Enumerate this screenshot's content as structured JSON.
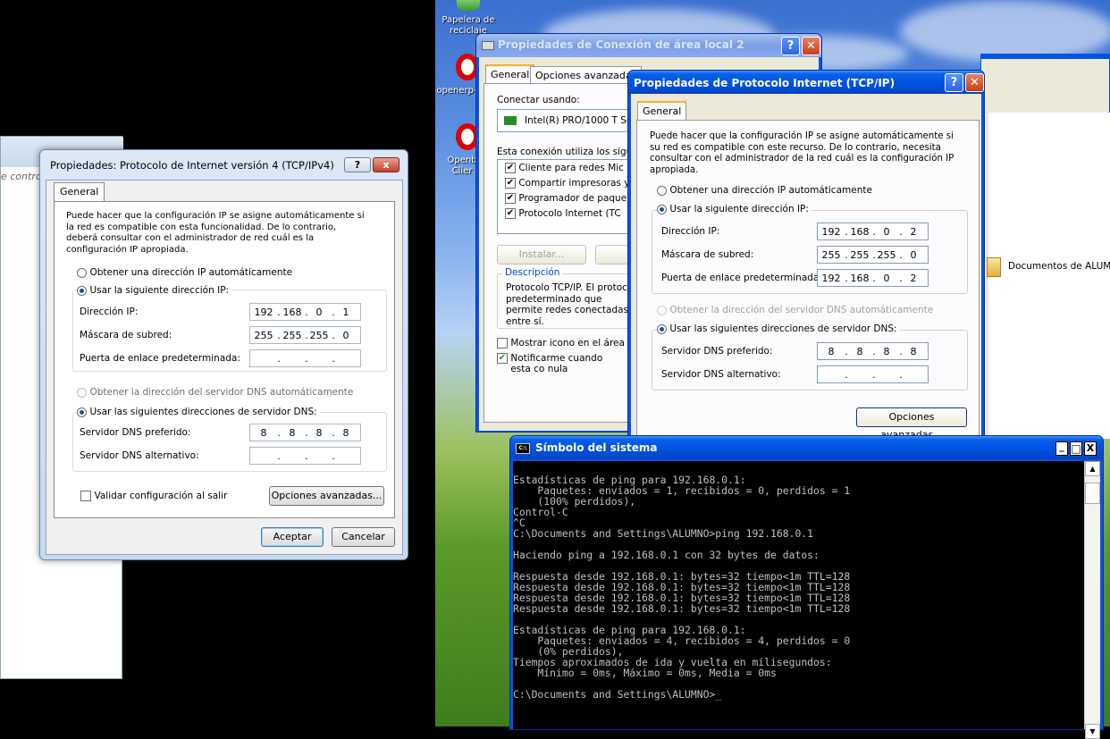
{
  "left_window": {
    "partial_text": "e contro",
    "dialog": {
      "title": "Propiedades: Protocolo de Internet versión 4 (TCP/IPv4)",
      "tab": "General",
      "description": "Puede hacer que la configuración IP se asigne automáticamente si la red es compatible con esta funcionalidad. De lo contrario, deberá consultar con el administrador de red cuál es la configuración IP apropiada.",
      "radio_auto_ip": "Obtener una dirección IP automáticamente",
      "radio_manual_ip": "Usar la siguiente dirección IP:",
      "ip_label": "Dirección IP:",
      "ip": [
        "192",
        "168",
        "0",
        "1"
      ],
      "mask_label": "Máscara de subred:",
      "mask": [
        "255",
        "255",
        "255",
        "0"
      ],
      "gateway_label": "Puerta de enlace predeterminada:",
      "gateway": [
        "",
        "",
        "",
        ""
      ],
      "radio_auto_dns": "Obtener la dirección del servidor DNS automáticamente",
      "radio_manual_dns": "Usar las siguientes direcciones de servidor DNS:",
      "dns_pref_label": "Servidor DNS preferido:",
      "dns_pref": [
        "8",
        "8",
        "8",
        "8"
      ],
      "dns_alt_label": "Servidor DNS alternativo:",
      "dns_alt": [
        "",
        "",
        "",
        ""
      ],
      "validate_label": "Validar configuración al salir",
      "advanced_button": "Opciones avanzadas...",
      "ok_button": "Aceptar",
      "cancel_button": "Cancelar",
      "help_glyph": "?",
      "close_glyph": "x"
    }
  },
  "desktop": {
    "icons": [
      "Papelera de reciclaje",
      "openerp-",
      "Openb Clier"
    ],
    "documents_label": "Documentos de ALUMNO"
  },
  "lan_dialog": {
    "title": "Propiedades de Conexión de área local 2",
    "tabs": [
      "General",
      "Opciones avanzadas"
    ],
    "connect_using_label": "Conectar usando:",
    "adapter": "Intel(R) PRO/1000 T Se",
    "components_label": "Esta conexión utiliza los siguien",
    "components": [
      "Cliente para redes Mic",
      "Compartir impresoras y",
      "Programador de paque",
      "Protocolo Internet (TC"
    ],
    "install_button": "Instalar...",
    "uninstall_button": "De",
    "description_title": "Descripción",
    "description_text": "Protocolo TCP/IP. El protoc predeterminado que permite redes conectadas entre sí.",
    "show_icon_label": "Mostrar icono en el área de",
    "notify_label": "Notificarme cuando esta co nula"
  },
  "tcp_dialog": {
    "title": "Propiedades de Protocolo Internet (TCP/IP)",
    "tab": "General",
    "description": "Puede hacer que la configuración IP se asigne automáticamente si su red es compatible con este recurso. De lo contrario, necesita consultar con el administrador de la red cuál es la configuración IP apropiada.",
    "radio_auto_ip": "Obtener una dirección IP automáticamente",
    "radio_manual_ip": "Usar la siguiente dirección IP:",
    "ip_label": "Dirección IP:",
    "ip": [
      "192",
      "168",
      "0",
      "2"
    ],
    "mask_label": "Máscara de subred:",
    "mask": [
      "255",
      "255",
      "255",
      "0"
    ],
    "gateway_label": "Puerta de enlace predeterminada:",
    "gateway": [
      "192",
      "168",
      "0",
      "2"
    ],
    "radio_auto_dns": "Obtener la dirección del servidor DNS automáticamente",
    "radio_manual_dns": "Usar las siguientes direcciones de servidor DNS:",
    "dns_pref_label": "Servidor DNS preferido:",
    "dns_pref": [
      "8",
      "8",
      "8",
      "8"
    ],
    "dns_alt_label": "Servidor DNS alternativo:",
    "dns_alt": [
      "",
      "",
      "",
      ""
    ],
    "advanced_button": "Opciones avanzadas..."
  },
  "cmd": {
    "title": "Símbolo del sistema",
    "icon_text": "C:\\",
    "lines": [
      "Estadísticas de ping para 192.168.0.1:",
      "    Paquetes: enviados = 1, recibidos = 0, perdidos = 1",
      "    (100% perdidos),",
      "Control-C",
      "^C",
      "C:\\Documents and Settings\\ALUMNO>ping 192.168.0.1",
      "",
      "Haciendo ping a 192.168.0.1 con 32 bytes de datos:",
      "",
      "Respuesta desde 192.168.0.1: bytes=32 tiempo<1m TTL=128",
      "Respuesta desde 192.168.0.1: bytes=32 tiempo<1m TTL=128",
      "Respuesta desde 192.168.0.1: bytes=32 tiempo<1m TTL=128",
      "Respuesta desde 192.168.0.1: bytes=32 tiempo<1m TTL=128",
      "",
      "Estadísticas de ping para 192.168.0.1:",
      "    Paquetes: enviados = 4, recibidos = 4, perdidos = 0",
      "    (0% perdidos),",
      "Tiempos aproximados de ida y vuelta en milisegundos:",
      "    Mínimo = 0ms, Máximo = 0ms, Media = 0ms",
      "",
      "C:\\Documents and Settings\\ALUMNO>"
    ],
    "cursor": "_",
    "minimize": "_",
    "maximize": "□",
    "close": "X"
  }
}
